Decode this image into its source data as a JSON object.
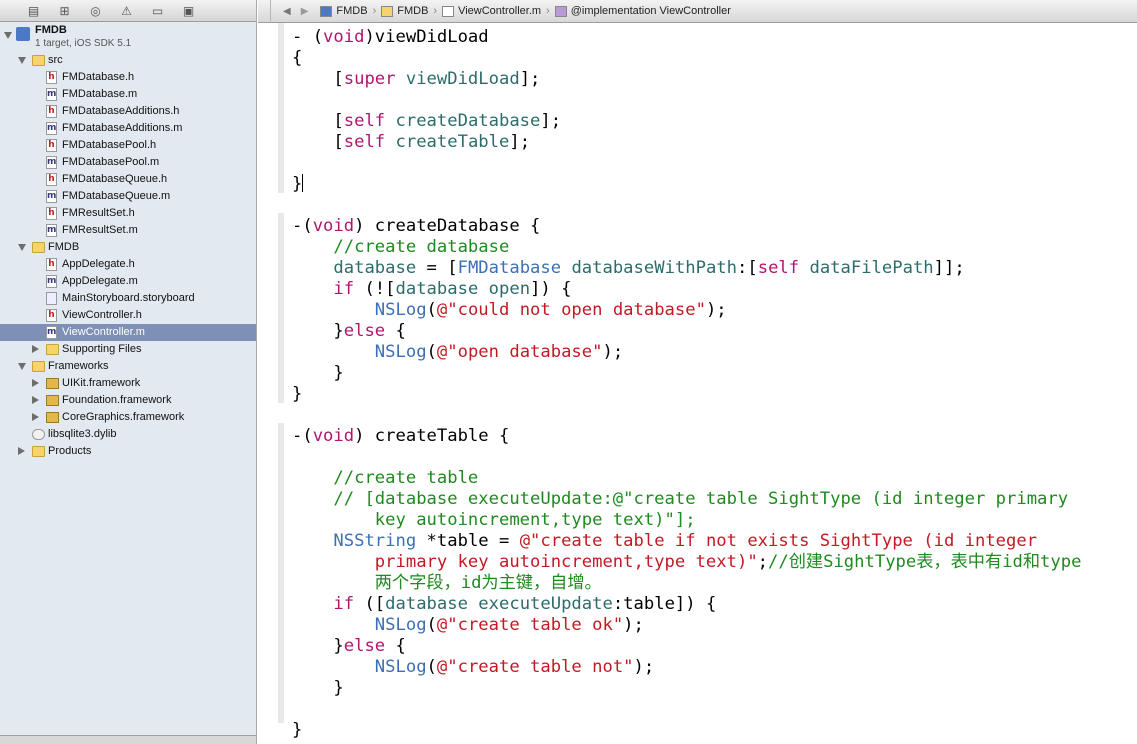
{
  "navigator": {
    "toolbar_icons": [
      "folder-icon",
      "hierarchy-icon",
      "search-icon",
      "warning-icon",
      "breakpoint-icon",
      "log-icon"
    ],
    "project": {
      "name": "FMDB",
      "subtitle": "1 target, iOS SDK 5.1"
    },
    "rows": [
      {
        "indent": 1,
        "arrow": "open",
        "icon": "folder",
        "label": "src"
      },
      {
        "indent": 2,
        "icon": "h",
        "label": "FMDatabase.h"
      },
      {
        "indent": 2,
        "icon": "m",
        "label": "FMDatabase.m"
      },
      {
        "indent": 2,
        "icon": "h",
        "label": "FMDatabaseAdditions.h"
      },
      {
        "indent": 2,
        "icon": "m",
        "label": "FMDatabaseAdditions.m"
      },
      {
        "indent": 2,
        "icon": "h",
        "label": "FMDatabasePool.h"
      },
      {
        "indent": 2,
        "icon": "m",
        "label": "FMDatabasePool.m"
      },
      {
        "indent": 2,
        "icon": "h",
        "label": "FMDatabaseQueue.h"
      },
      {
        "indent": 2,
        "icon": "m",
        "label": "FMDatabaseQueue.m"
      },
      {
        "indent": 2,
        "icon": "h",
        "label": "FMResultSet.h"
      },
      {
        "indent": 2,
        "icon": "m",
        "label": "FMResultSet.m"
      },
      {
        "indent": 1,
        "arrow": "open",
        "icon": "folder",
        "label": "FMDB"
      },
      {
        "indent": 2,
        "icon": "h",
        "label": "AppDelegate.h"
      },
      {
        "indent": 2,
        "icon": "m",
        "label": "AppDelegate.m"
      },
      {
        "indent": 2,
        "icon": "storyboard",
        "label": "MainStoryboard.storyboard"
      },
      {
        "indent": 2,
        "icon": "h",
        "label": "ViewController.h"
      },
      {
        "indent": 2,
        "icon": "m",
        "label": "ViewController.m",
        "selected": true
      },
      {
        "indent": 2,
        "arrow": "closed",
        "icon": "folder",
        "label": "Supporting Files"
      },
      {
        "indent": 1,
        "arrow": "open",
        "icon": "folder",
        "label": "Frameworks"
      },
      {
        "indent": 2,
        "arrow": "closed",
        "icon": "framework",
        "label": "UIKit.framework"
      },
      {
        "indent": 2,
        "arrow": "closed",
        "icon": "framework",
        "label": "Foundation.framework"
      },
      {
        "indent": 2,
        "arrow": "closed",
        "icon": "framework",
        "label": "CoreGraphics.framework"
      },
      {
        "indent": 1,
        "icon": "library",
        "label": "libsqlite3.dylib"
      },
      {
        "indent": 1,
        "arrow": "closed",
        "icon": "folder",
        "label": "Products"
      }
    ]
  },
  "jumpbar": {
    "back": "◀",
    "forward": "▶",
    "crumbs": [
      {
        "icon": "project",
        "label": "FMDB"
      },
      {
        "icon": "folder",
        "label": "FMDB"
      },
      {
        "icon": "m",
        "label": "ViewController.m"
      },
      {
        "icon": "class",
        "label": "@implementation ViewController"
      }
    ],
    "separator": "›"
  },
  "colors": {
    "keyword": "#b0166f",
    "type": "#3d6fb5",
    "comment": "#1f8a1f",
    "string": "#c21a24",
    "function": "#2e6b6b",
    "macro": "#6a1fa1",
    "selection": "#7e90b5"
  },
  "code": [
    [
      [
        "",
        "- ("
      ],
      [
        "kw",
        "void"
      ],
      [
        "",
        ")viewDidLoad"
      ]
    ],
    [
      [
        "",
        "{"
      ]
    ],
    [
      [
        "",
        "    ["
      ],
      [
        "kw",
        "super"
      ],
      [
        "",
        ""
      ],
      [
        "fn",
        " viewDidLoad"
      ],
      [
        "",
        "];"
      ]
    ],
    [],
    [
      [
        "",
        "    ["
      ],
      [
        "kw",
        "self"
      ],
      [
        "fn",
        " createDatabase"
      ],
      [
        "",
        "];"
      ]
    ],
    [
      [
        "",
        "    ["
      ],
      [
        "kw",
        "self"
      ],
      [
        "fn",
        " createTable"
      ],
      [
        "",
        "];"
      ]
    ],
    [],
    [
      [
        "",
        "}"
      ],
      [
        "caret",
        ""
      ]
    ],
    [],
    [
      [
        "",
        "-("
      ],
      [
        "kw",
        "void"
      ],
      [
        "",
        ") createDatabase {"
      ]
    ],
    [
      [
        "",
        "    "
      ],
      [
        "cm",
        "//create database"
      ]
    ],
    [
      [
        "",
        "    "
      ],
      [
        "fn",
        "database"
      ],
      [
        "",
        " = ["
      ],
      [
        "tp",
        "FMDatabase"
      ],
      [
        "fn",
        " databaseWithPath"
      ],
      [
        "",
        ":["
      ],
      [
        "kw",
        "self"
      ],
      [
        "fn",
        " dataFilePath"
      ],
      [
        "",
        "]];"
      ]
    ],
    [
      [
        "",
        "    "
      ],
      [
        "kw",
        "if"
      ],
      [
        "",
        " (!["
      ],
      [
        "fn",
        "database"
      ],
      [
        "fn",
        " open"
      ],
      [
        "",
        "]) {"
      ]
    ],
    [
      [
        "",
        "        "
      ],
      [
        "tp",
        "NSLog"
      ],
      [
        "",
        "("
      ],
      [
        "st",
        "@\"could not open database\""
      ],
      [
        "",
        ");"
      ]
    ],
    [
      [
        "",
        "    }"
      ],
      [
        "kw",
        "else"
      ],
      [
        "",
        " {"
      ]
    ],
    [
      [
        "",
        "        "
      ],
      [
        "tp",
        "NSLog"
      ],
      [
        "",
        "("
      ],
      [
        "st",
        "@\"open database\""
      ],
      [
        "",
        ");"
      ]
    ],
    [
      [
        "",
        "    }"
      ]
    ],
    [
      [
        "",
        "}"
      ]
    ],
    [],
    [
      [
        "",
        "-("
      ],
      [
        "kw",
        "void"
      ],
      [
        "",
        ") createTable {"
      ]
    ],
    [],
    [
      [
        "",
        "    "
      ],
      [
        "cm",
        "//create table"
      ]
    ],
    [
      [
        "",
        "    "
      ],
      [
        "cm",
        "// [database executeUpdate:@\"create table SightType (id integer primary"
      ]
    ],
    [
      [
        "",
        "        "
      ],
      [
        "cm",
        "key autoincrement,type text)\"];"
      ]
    ],
    [
      [
        "",
        "    "
      ],
      [
        "tp",
        "NSString"
      ],
      [
        "",
        " *table = "
      ],
      [
        "st",
        "@\"create table if not exists SightType (id integer"
      ]
    ],
    [
      [
        "",
        "        "
      ],
      [
        "st",
        "primary key autoincrement,type text)\""
      ],
      [
        "",
        ";"
      ],
      [
        "cm",
        "//创建SightType表，表中有id和type"
      ]
    ],
    [
      [
        "",
        "        "
      ],
      [
        "cm",
        "两个字段，id为主键，自增。"
      ]
    ],
    [
      [
        "",
        "    "
      ],
      [
        "kw",
        "if"
      ],
      [
        "",
        " (["
      ],
      [
        "fn",
        "database"
      ],
      [
        "fn",
        " executeUpdate"
      ],
      [
        "",
        ":table]) {"
      ]
    ],
    [
      [
        "",
        "        "
      ],
      [
        "tp",
        "NSLog"
      ],
      [
        "",
        "("
      ],
      [
        "st",
        "@\"create table ok\""
      ],
      [
        "",
        ");"
      ]
    ],
    [
      [
        "",
        "    }"
      ],
      [
        "kw",
        "else"
      ],
      [
        "",
        " {"
      ]
    ],
    [
      [
        "",
        "        "
      ],
      [
        "tp",
        "NSLog"
      ],
      [
        "",
        "("
      ],
      [
        "st",
        "@\"create table not\""
      ],
      [
        "",
        ");"
      ]
    ],
    [
      [
        "",
        "    }"
      ]
    ],
    [],
    [
      [
        "",
        "}"
      ]
    ]
  ]
}
